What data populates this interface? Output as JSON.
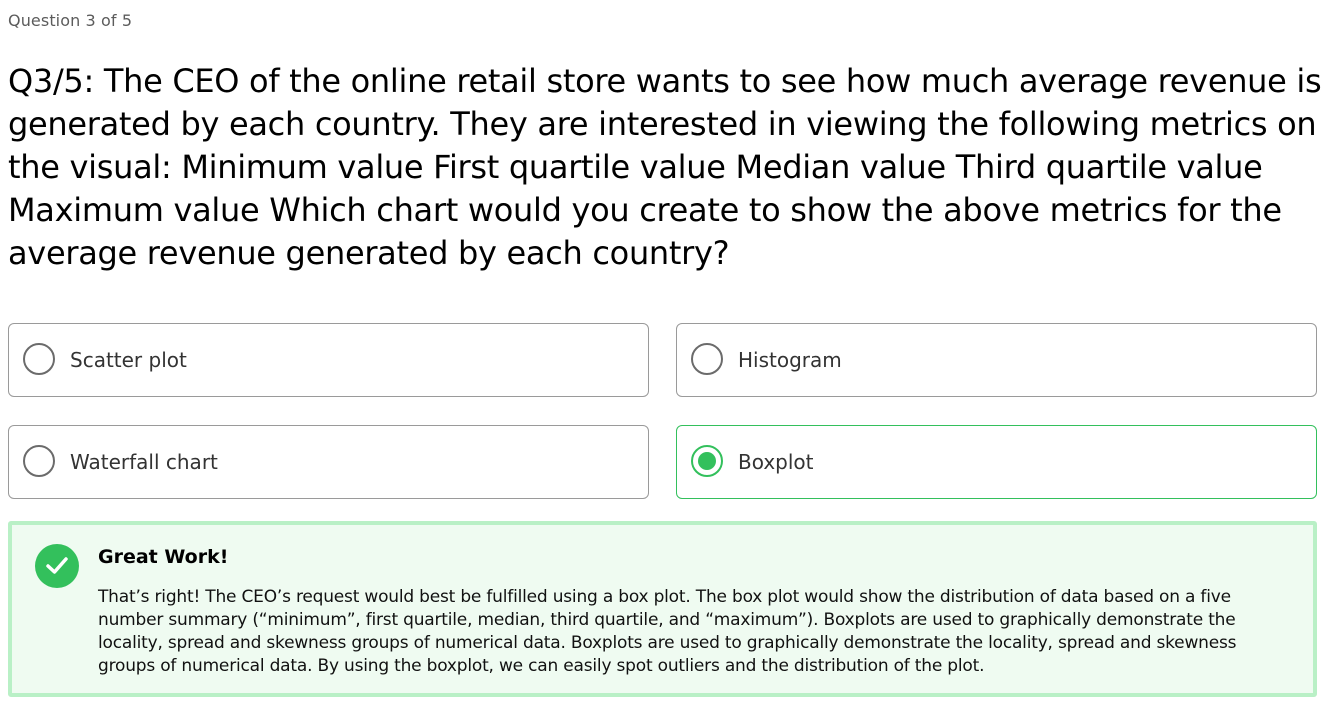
{
  "header": {
    "progress": "Question 3 of 5"
  },
  "question": {
    "text": "Q3/5: The CEO of the online retail store wants to see how much average revenue is generated by each country. They are interested in viewing the following metrics on the visual: Minimum value First quartile value Median value Third quartile value Maximum value Which chart would you create to show the above metrics for the average revenue generated by each country?"
  },
  "options": [
    {
      "label": "Scatter plot",
      "selected": false
    },
    {
      "label": "Histogram",
      "selected": false
    },
    {
      "label": "Waterfall chart",
      "selected": false
    },
    {
      "label": "Boxplot",
      "selected": true
    }
  ],
  "feedback": {
    "title": "Great Work!",
    "body": "That’s right! The CEO’s request would best be fulfilled using a box plot. The box plot would show the distribution of data based on a five number summary (“minimum”, first quartile, median, third quartile, and “maximum”). Boxplots are used to graphically demonstrate the locality, spread and skewness groups of numerical data. Boxplots are used to graphically demonstrate the locality, spread and skewness groups of numerical data. By using the boxplot, we can easily spot outliers and the distribution of the plot.",
    "icon": "check-icon"
  },
  "colors": {
    "accent_green": "#33c05c",
    "feedback_bg": "#effbf1",
    "feedback_border": "#b9f0c6",
    "option_border": "#9a9a9a"
  }
}
